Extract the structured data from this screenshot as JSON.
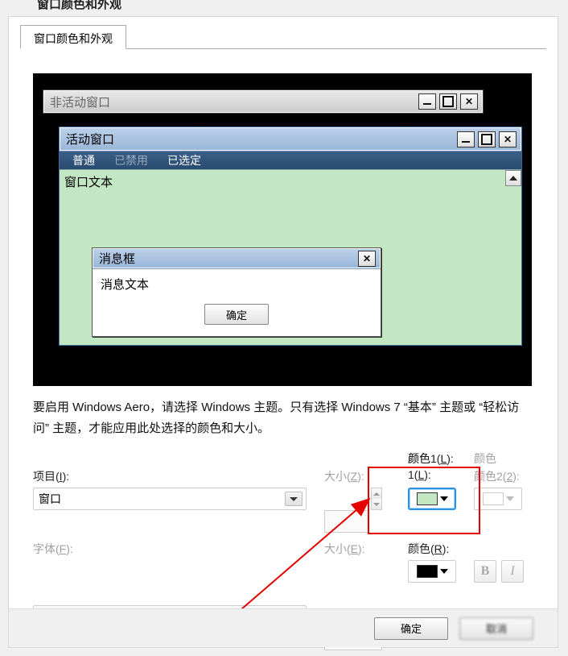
{
  "parent_title": "窗口颜色和外观",
  "tabs": {
    "main": "窗口颜色和外观"
  },
  "preview": {
    "inactive_title": "非活动窗口",
    "active_title": "活动窗口",
    "menu": {
      "normal": "普通",
      "disabled": "已禁用",
      "selected": "已选定"
    },
    "client_text": "窗口文本",
    "msgbox": {
      "title": "消息框",
      "body": "消息文本",
      "ok": "确定"
    }
  },
  "instruction": "要启用 Windows Aero，请选择 Windows 主题。只有选择 Windows 7 “基本” 主题或 “轻松访问” 主题，才能应用此处选择的颜色和大小。",
  "labels": {
    "item": "项目(",
    "item_u": "I",
    "item_suf": "):",
    "size": "大小(",
    "size_u": "Z",
    "size_suf": "):",
    "color1": "颜色1(",
    "color1_u": "L",
    "color1_suf": "):",
    "color2": "颜色2(",
    "color2_u": "2",
    "color2_suf": "):",
    "font": "字体(",
    "font_u": "F",
    "font_suf": "):",
    "sizeE": "大小(",
    "sizeE_u": "E",
    "sizeE_suf": "):",
    "colorR": "颜色(",
    "colorR_u": "R",
    "colorR_suf": "):"
  },
  "values": {
    "item_selected": "窗口",
    "color1_swatch": "#c3e6c3",
    "colorR_swatch": "#000000"
  },
  "dialog": {
    "ok": "确定",
    "cancel": "取消"
  }
}
